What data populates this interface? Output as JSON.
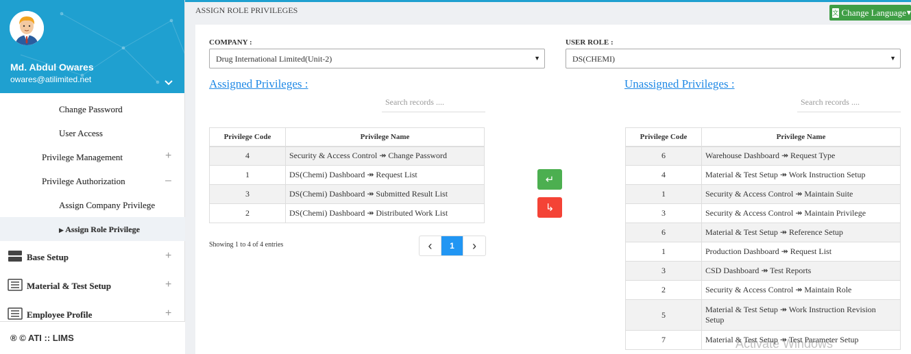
{
  "profile": {
    "name": "Md. Abdul Owares",
    "email": "owares@atilimited.net"
  },
  "sidebar": {
    "items": [
      {
        "label": "Change Password"
      },
      {
        "label": "User Access"
      },
      {
        "label": "Privilege Management",
        "toggle": "+"
      },
      {
        "label": "Privilege Authorization",
        "toggle": "–"
      },
      {
        "label": "Assign Company Privilege"
      },
      {
        "label": "Assign Role Privilege",
        "active": true
      },
      {
        "label": "Base Setup",
        "toggle": "+"
      },
      {
        "label": "Material & Test Setup",
        "toggle": "+"
      },
      {
        "label": "Employee Profile",
        "toggle": "+"
      }
    ],
    "footer": "® © ATI :: LIMS"
  },
  "header": {
    "title": "ASSIGN ROLE PRIVILEGES",
    "language_button": "Change Language"
  },
  "form": {
    "company_label": "COMPANY :",
    "company_value": "Drug International Limited(Unit-2)",
    "role_label": "USER ROLE :",
    "role_value": "DS(CHEMI)"
  },
  "assigned": {
    "title": "Assigned Privileges :",
    "search_placeholder": "Search records ....",
    "columns": [
      "Privilege Code",
      "Privilege Name"
    ],
    "rows": [
      [
        "4",
        "Security & Access Control ↠ Change Password"
      ],
      [
        "1",
        "DS(Chemi) Dashboard ↠ Request List"
      ],
      [
        "3",
        "DS(Chemi) Dashboard ↠ Submitted Result List"
      ],
      [
        "2",
        "DS(Chemi) Dashboard ↠ Distributed Work List"
      ]
    ],
    "showing": "Showing 1 to 4 of 4 entries",
    "pager": {
      "prev": "‹",
      "current": "1",
      "next": "›"
    }
  },
  "unassigned": {
    "title": "Unassigned Privileges :",
    "search_placeholder": "Search records ....",
    "columns": [
      "Privilege Code",
      "Privilege Name"
    ],
    "rows": [
      [
        "6",
        "Warehouse Dashboard ↠ Request Type"
      ],
      [
        "4",
        "Material & Test Setup ↠ Work Instruction Setup"
      ],
      [
        "1",
        "Security & Access Control ↠ Maintain Suite"
      ],
      [
        "3",
        "Security & Access Control ↠ Maintain Privilege"
      ],
      [
        "6",
        "Material & Test Setup ↠ Reference Setup"
      ],
      [
        "1",
        "Production Dashboard ↠ Request List"
      ],
      [
        "3",
        "CSD Dashboard ↠ Test Reports"
      ],
      [
        "2",
        "Security & Access Control ↠ Maintain Role"
      ],
      [
        "5",
        "Material & Test Setup ↠ Work Instruction Revision Setup"
      ],
      [
        "7",
        "Material & Test Setup ↠ Test Parameter Setup"
      ]
    ]
  },
  "actions": {
    "assign_icon": "↵",
    "unassign_icon": "↳"
  },
  "watermark": "Activate Windows",
  "colors": {
    "primary": "#1fa0d0",
    "link": "#1e88e5",
    "assign": "#4caf50",
    "unassign": "#f44336",
    "page_active": "#2196f3"
  }
}
